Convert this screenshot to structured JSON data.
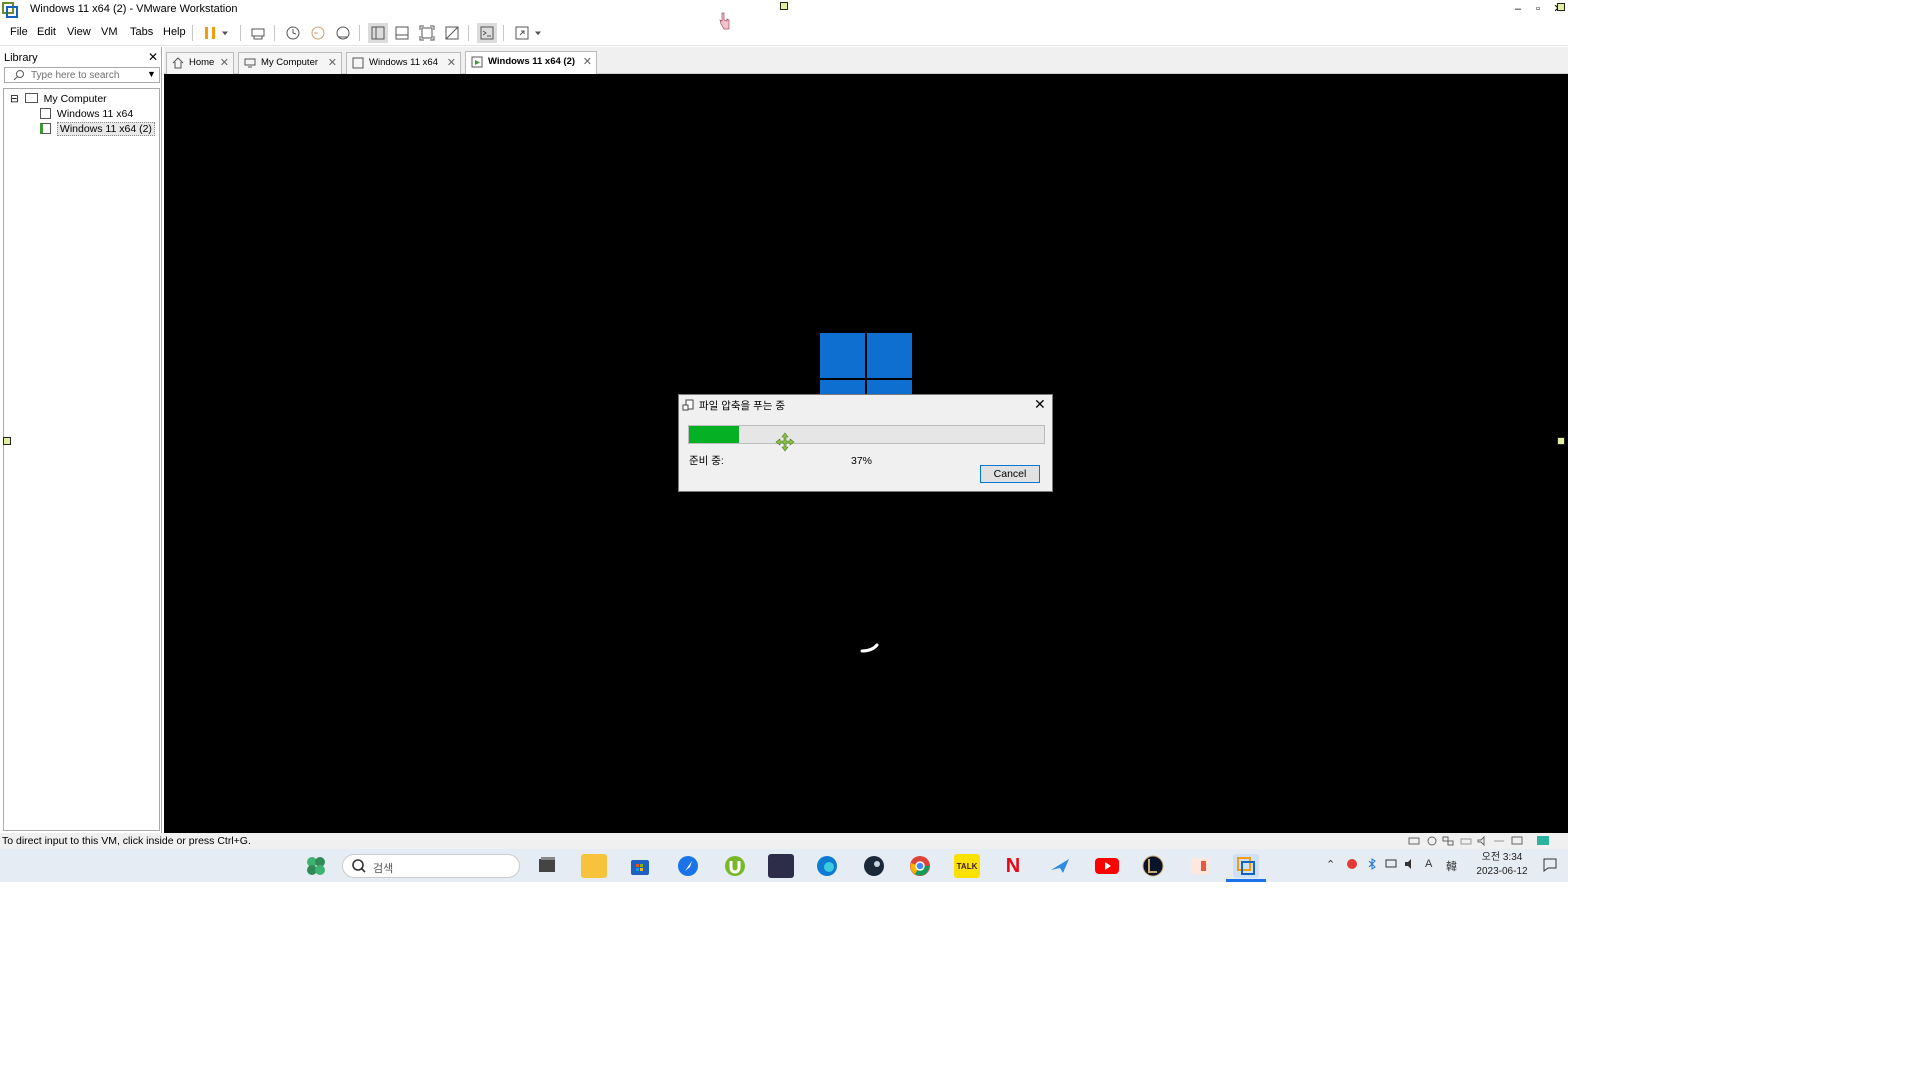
{
  "window": {
    "title": "Windows 11 x64 (2) - VMware Workstation",
    "min_glyph": "–",
    "max_glyph": "▫",
    "close_glyph": "✕"
  },
  "menu": {
    "items": [
      "File",
      "Edit",
      "View",
      "VM",
      "Tabs",
      "Help"
    ]
  },
  "library": {
    "title": "Library",
    "close_glyph": "✕",
    "search_placeholder": "Type here to search",
    "tree": {
      "expander": "⊟",
      "root": "My Computer",
      "children": [
        "Windows 11 x64",
        "Windows 11 x64 (2)"
      ],
      "selected_index": 1
    }
  },
  "tabs": [
    {
      "label": "Home",
      "icon": "home-icon",
      "active": false
    },
    {
      "label": "My Computer",
      "icon": "computer-icon",
      "active": false
    },
    {
      "label": "Windows 11 x64",
      "icon": "vm-icon",
      "active": false
    },
    {
      "label": "Windows 11 x64 (2)",
      "icon": "vm-running-icon",
      "active": true
    }
  ],
  "dialog": {
    "title": "파일 압축을 푸는 중",
    "close_glyph": "✕",
    "status_label": "준비 중:",
    "percent_text": "37%",
    "progress_fraction": 0.14,
    "cancel_label": "Cancel"
  },
  "status_bar": {
    "message": "To direct input to this VM, click inside or press Ctrl+G."
  },
  "taskbar": {
    "search_placeholder": "검색",
    "apps": [
      "widgets-icon",
      "task-view-icon",
      "file-explorer-icon",
      "microsoft-store-icon",
      "copilot-arrow-icon",
      "utorrent-icon",
      "app-icon",
      "edge-icon",
      "steam-icon",
      "chrome-icon",
      "kakaotalk-icon",
      "netflix-icon",
      "bird-app-icon",
      "youtube-icon",
      "league-of-legends-icon",
      "image-app-icon",
      "vmware-icon"
    ],
    "kakaotalk_label": "TALK",
    "netflix_label": "N",
    "tray_ime": "A",
    "tray_lang": "韓",
    "clock_time": "오전 3:34",
    "clock_date": "2023-06-12"
  },
  "colors": {
    "progress_green": "#06b025",
    "windows_blue": "#0f6fd1",
    "vm_background": "#000000",
    "cancel_border": "#0078d7"
  }
}
